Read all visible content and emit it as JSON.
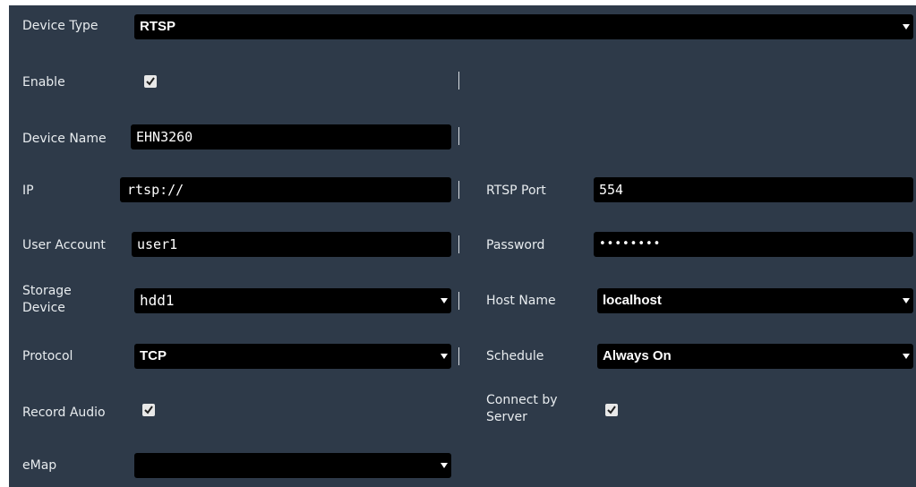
{
  "form": {
    "device_type": {
      "label": "Device Type",
      "value": "RTSP"
    },
    "enable": {
      "label": "Enable",
      "checked": true
    },
    "device_name": {
      "label": "Device Name",
      "value": "EHN3260"
    },
    "ip": {
      "label": "IP",
      "value": "rtsp://"
    },
    "rtsp_port": {
      "label": "RTSP Port",
      "value": "554"
    },
    "user_account": {
      "label": "User Account",
      "value": "user1"
    },
    "password": {
      "label": "Password",
      "value": "••••••••"
    },
    "storage_device": {
      "label": "Storage Device",
      "value": "hdd1"
    },
    "host_name": {
      "label": "Host Name",
      "value": "localhost"
    },
    "protocol": {
      "label": "Protocol",
      "value": "TCP"
    },
    "schedule": {
      "label": "Schedule",
      "value": "Always On"
    },
    "record_audio": {
      "label": "Record Audio",
      "checked": true
    },
    "connect_by_server": {
      "label": "Connect by Server",
      "checked": true
    },
    "emap": {
      "label": "eMap",
      "value": ""
    }
  },
  "colors": {
    "panel_bg": "#2e3a49",
    "field_bg": "#000000",
    "text": "#e8ecef"
  }
}
